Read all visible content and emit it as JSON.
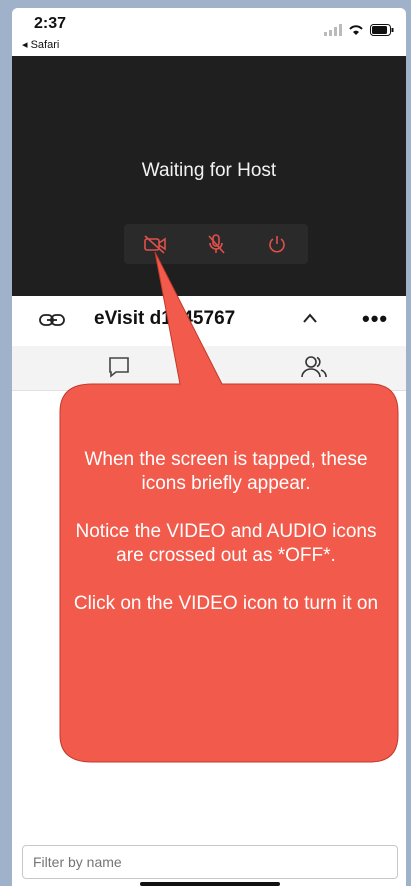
{
  "status_bar": {
    "time": "2:37",
    "back_app": "◂ Safari"
  },
  "video": {
    "waiting_text": "Waiting for Host",
    "controls": [
      {
        "icon": "video-off-icon",
        "state": "off",
        "color": "#e0504a"
      },
      {
        "icon": "mic-off-icon",
        "state": "off",
        "color": "#e0504a"
      },
      {
        "icon": "power-icon",
        "color": "#e0504a"
      }
    ]
  },
  "toolbar": {
    "meeting_id": "eVisit d1745767",
    "link_icon": "link-icon",
    "chevron_icon": "chevron-up-icon",
    "more_label": "•••"
  },
  "tabs": [
    {
      "icon": "chat-icon"
    },
    {
      "icon": "people-icon"
    }
  ],
  "filter": {
    "placeholder": "Filter by name"
  },
  "callout": {
    "color": "#f25b4c",
    "line1": "When the screen is tapped, these icons briefly appear.",
    "line2": "Notice the VIDEO and AUDIO icons are crossed out as *OFF*.",
    "line3": "Click on the VIDEO icon to turn it on"
  }
}
